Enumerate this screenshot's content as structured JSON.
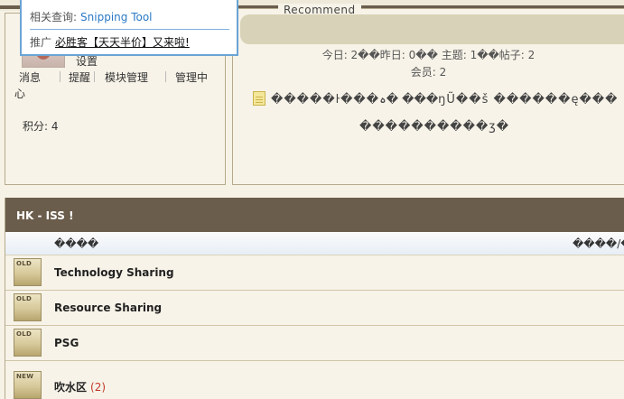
{
  "popup": {
    "related_label": "相关查询:",
    "related_link": "Snipping Tool",
    "promo_label": "推广",
    "promo_link": "必胜客【天天半价】又来啦!"
  },
  "user_panel": {
    "settings": "设置",
    "nav": [
      "消息",
      "提醒",
      "模块管理",
      "管理中"
    ],
    "nav_wrap": "心",
    "points": "积分: 4"
  },
  "recommend": {
    "tab_label": "Recommend",
    "stats_line1": "今日: 2��昨日: 0�� 主题: 1��帖子: 2",
    "stats_line2": "会员: 2",
    "notice_line1": "�����ŀ���ہ� ���ŋŨ��š ������ę���",
    "notice_line2": "����������ʒ�"
  },
  "forum": {
    "section_title": "HK - ISS !",
    "col_forum": "����",
    "col_posts": "����/�",
    "boards": [
      {
        "badge": "OLD",
        "name": "Technology Sharing",
        "count": ""
      },
      {
        "badge": "OLD",
        "name": "Resource Sharing",
        "count": ""
      },
      {
        "badge": "OLD",
        "name": "PSG",
        "count": ""
      },
      {
        "badge": "NEW",
        "name": "吹水区",
        "count": "(2)"
      }
    ]
  }
}
